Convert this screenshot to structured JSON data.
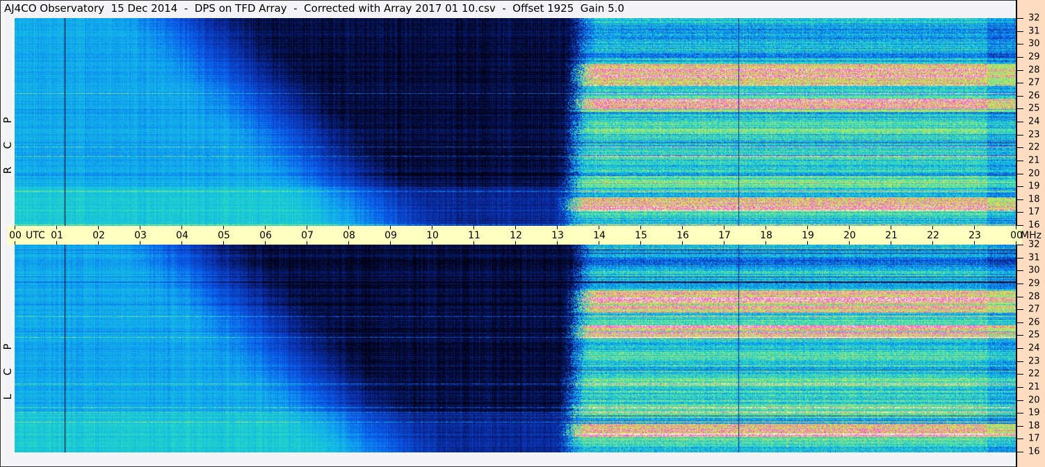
{
  "title": "AJ4CO Observatory  15 Dec 2014  -  DPS on TFD Array  -  Corrected with Array 2017 01 10.csv  -  Offset 1925  Gain 5.0",
  "time_axis": {
    "utc_label": "UTC",
    "unit_label": "MHz",
    "ticks": [
      "00",
      "01",
      "02",
      "03",
      "04",
      "05",
      "06",
      "07",
      "08",
      "09",
      "10",
      "11",
      "12",
      "13",
      "14",
      "15",
      "16",
      "17",
      "18",
      "19",
      "20",
      "21",
      "22",
      "23",
      "00"
    ]
  },
  "freq_ticks": [
    "32",
    "31",
    "30",
    "29",
    "28",
    "27",
    "26",
    "25",
    "24",
    "23",
    "22",
    "21",
    "20",
    "19",
    "18",
    "17",
    "16"
  ],
  "panels": [
    {
      "pol_letters": [
        "R",
        "C",
        "P"
      ]
    },
    {
      "pol_letters": [
        "L",
        "C",
        "P"
      ]
    }
  ],
  "chart_data": {
    "type": "heatmap",
    "title": "AJ4CO Observatory  15 Dec 2014  -  DPS on TFD Array  -  Corrected with Array 2017 01 10.csv  -  Offset 1925  Gain 5.0",
    "xlabel": "UTC",
    "ylabel": "MHz",
    "xlim": [
      0,
      24
    ],
    "ylim": [
      16,
      32
    ],
    "panels": [
      "RCP",
      "LCP"
    ],
    "colormap": [
      "#000010",
      "#0a2aa0",
      "#0a5ae8",
      "#10a8f0",
      "#20d8c8",
      "#90e880",
      "#e8e840",
      "#f040e0",
      "#ffffff"
    ],
    "features": {
      "night_dark_hours": [
        4,
        13.3
      ],
      "daytime_onset_hours": 13.3,
      "bright_bands_mhz": [
        [
          26.8,
          28.5
        ],
        [
          24.8,
          25.8
        ],
        [
          17.2,
          18.2
        ]
      ],
      "vertical_lines_hours": [
        1.2,
        17.35
      ]
    }
  }
}
